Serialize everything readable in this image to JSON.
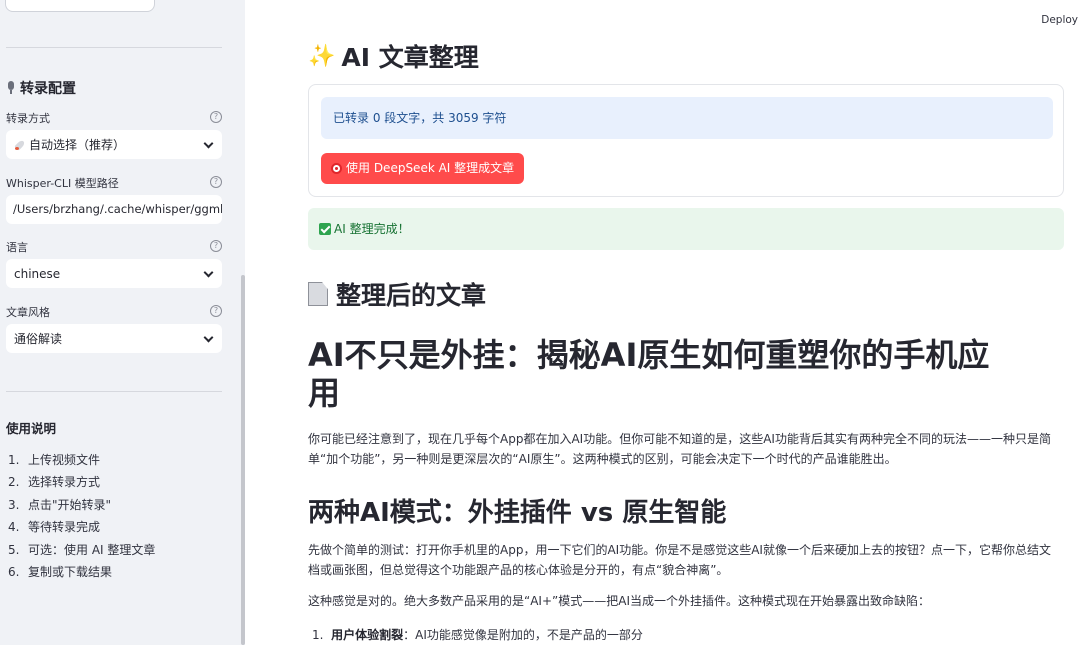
{
  "sidebar": {
    "config_title": "转录配置",
    "fields": [
      {
        "label": "转录方式",
        "value": "自动选择（推荐）",
        "type": "select"
      },
      {
        "label": "Whisper-CLI 模型路径",
        "value": "/Users/brzhang/.cache/whisper/ggml-b",
        "type": "input"
      },
      {
        "label": "语言",
        "value": "chinese",
        "type": "select"
      },
      {
        "label": "文章风格",
        "value": "通俗解读",
        "type": "select"
      }
    ],
    "help_glyph": "?",
    "usage_title": "使用说明",
    "usage_steps": [
      {
        "num": "1.",
        "text": "上传视频文件"
      },
      {
        "num": "2.",
        "text": "选择转录方式"
      },
      {
        "num": "3.",
        "text": "点击\"开始转录\""
      },
      {
        "num": "4.",
        "text": "等待转录完成"
      },
      {
        "num": "5.",
        "text": "可选：使用 AI 整理文章"
      },
      {
        "num": "6.",
        "text": "复制或下载结果"
      }
    ]
  },
  "header": {
    "deploy_label": "Deploy"
  },
  "main": {
    "title": "AI 文章整理",
    "title_icon": "sparkles-icon",
    "info_text": "已转录 0 段文字，共 3059 字符",
    "ai_button_label": "使用 DeepSeek AI 整理成文章",
    "success_text": "AI 整理完成！",
    "section_title": "整理后的文章",
    "article": {
      "h1_line1": "AI不只是外挂：揭秘AI原生如何重塑你的手机应",
      "h1_line2": "用",
      "p1_line1": "你可能已经注意到了，现在几乎每个App都在加入AI功能。但你可能不知道的是，这些AI功能背后其实有两种完全不同的玩法——一种只是简",
      "p1_line2": "单“加个功能”，另一种则是更深层次的“AI原生”。这两种模式的区别，可能会决定下一个时代的产品谁能胜出。",
      "h2": "两种AI模式：外挂插件 vs 原生智能",
      "p2_line1": "先做个简单的测试：打开你手机里的App，用一下它们的AI功能。你是不是感觉这些AI就像一个后来硬加上去的按钮？点一下，它帮你总结文",
      "p2_line2": "档或画张图，但总觉得这个功能跟产品的核心体验是分开的，有点“貌合神离”。",
      "p3": "这种感觉是对的。绝大多数产品采用的是“AI+”模式——把AI当成一个外挂插件。这种模式现在开始暴露出致命缺陷：",
      "list_item_num": "1.",
      "list_item_bold": "用户体验割裂",
      "list_item_text": "：AI功能感觉像是附加的，不是产品的一部分"
    }
  },
  "colors": {
    "primary_button": "#ff4b4b",
    "info_bg": "#e8f0fd",
    "success_bg": "#e9f6ec",
    "sidebar_bg": "#f0f2f6"
  }
}
